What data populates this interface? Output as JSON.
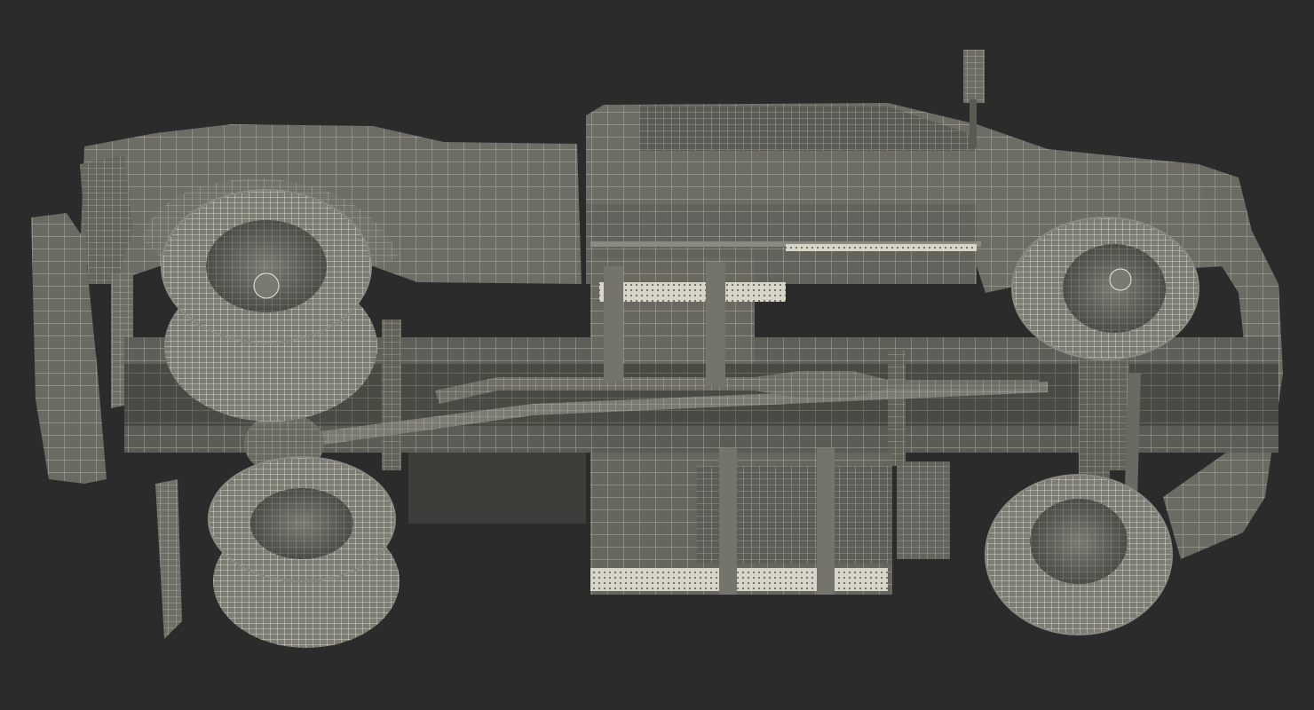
{
  "scene": {
    "subject": "truck-underside-wireframe-render",
    "colors": {
      "background": "#2b2b2b",
      "body": "#6d6d66",
      "body_dark": "#55554f",
      "body_shadow": "#44443f",
      "wire": "#e9e8dc",
      "tire": "#7a7a72",
      "frame": "#5f5f59"
    }
  }
}
